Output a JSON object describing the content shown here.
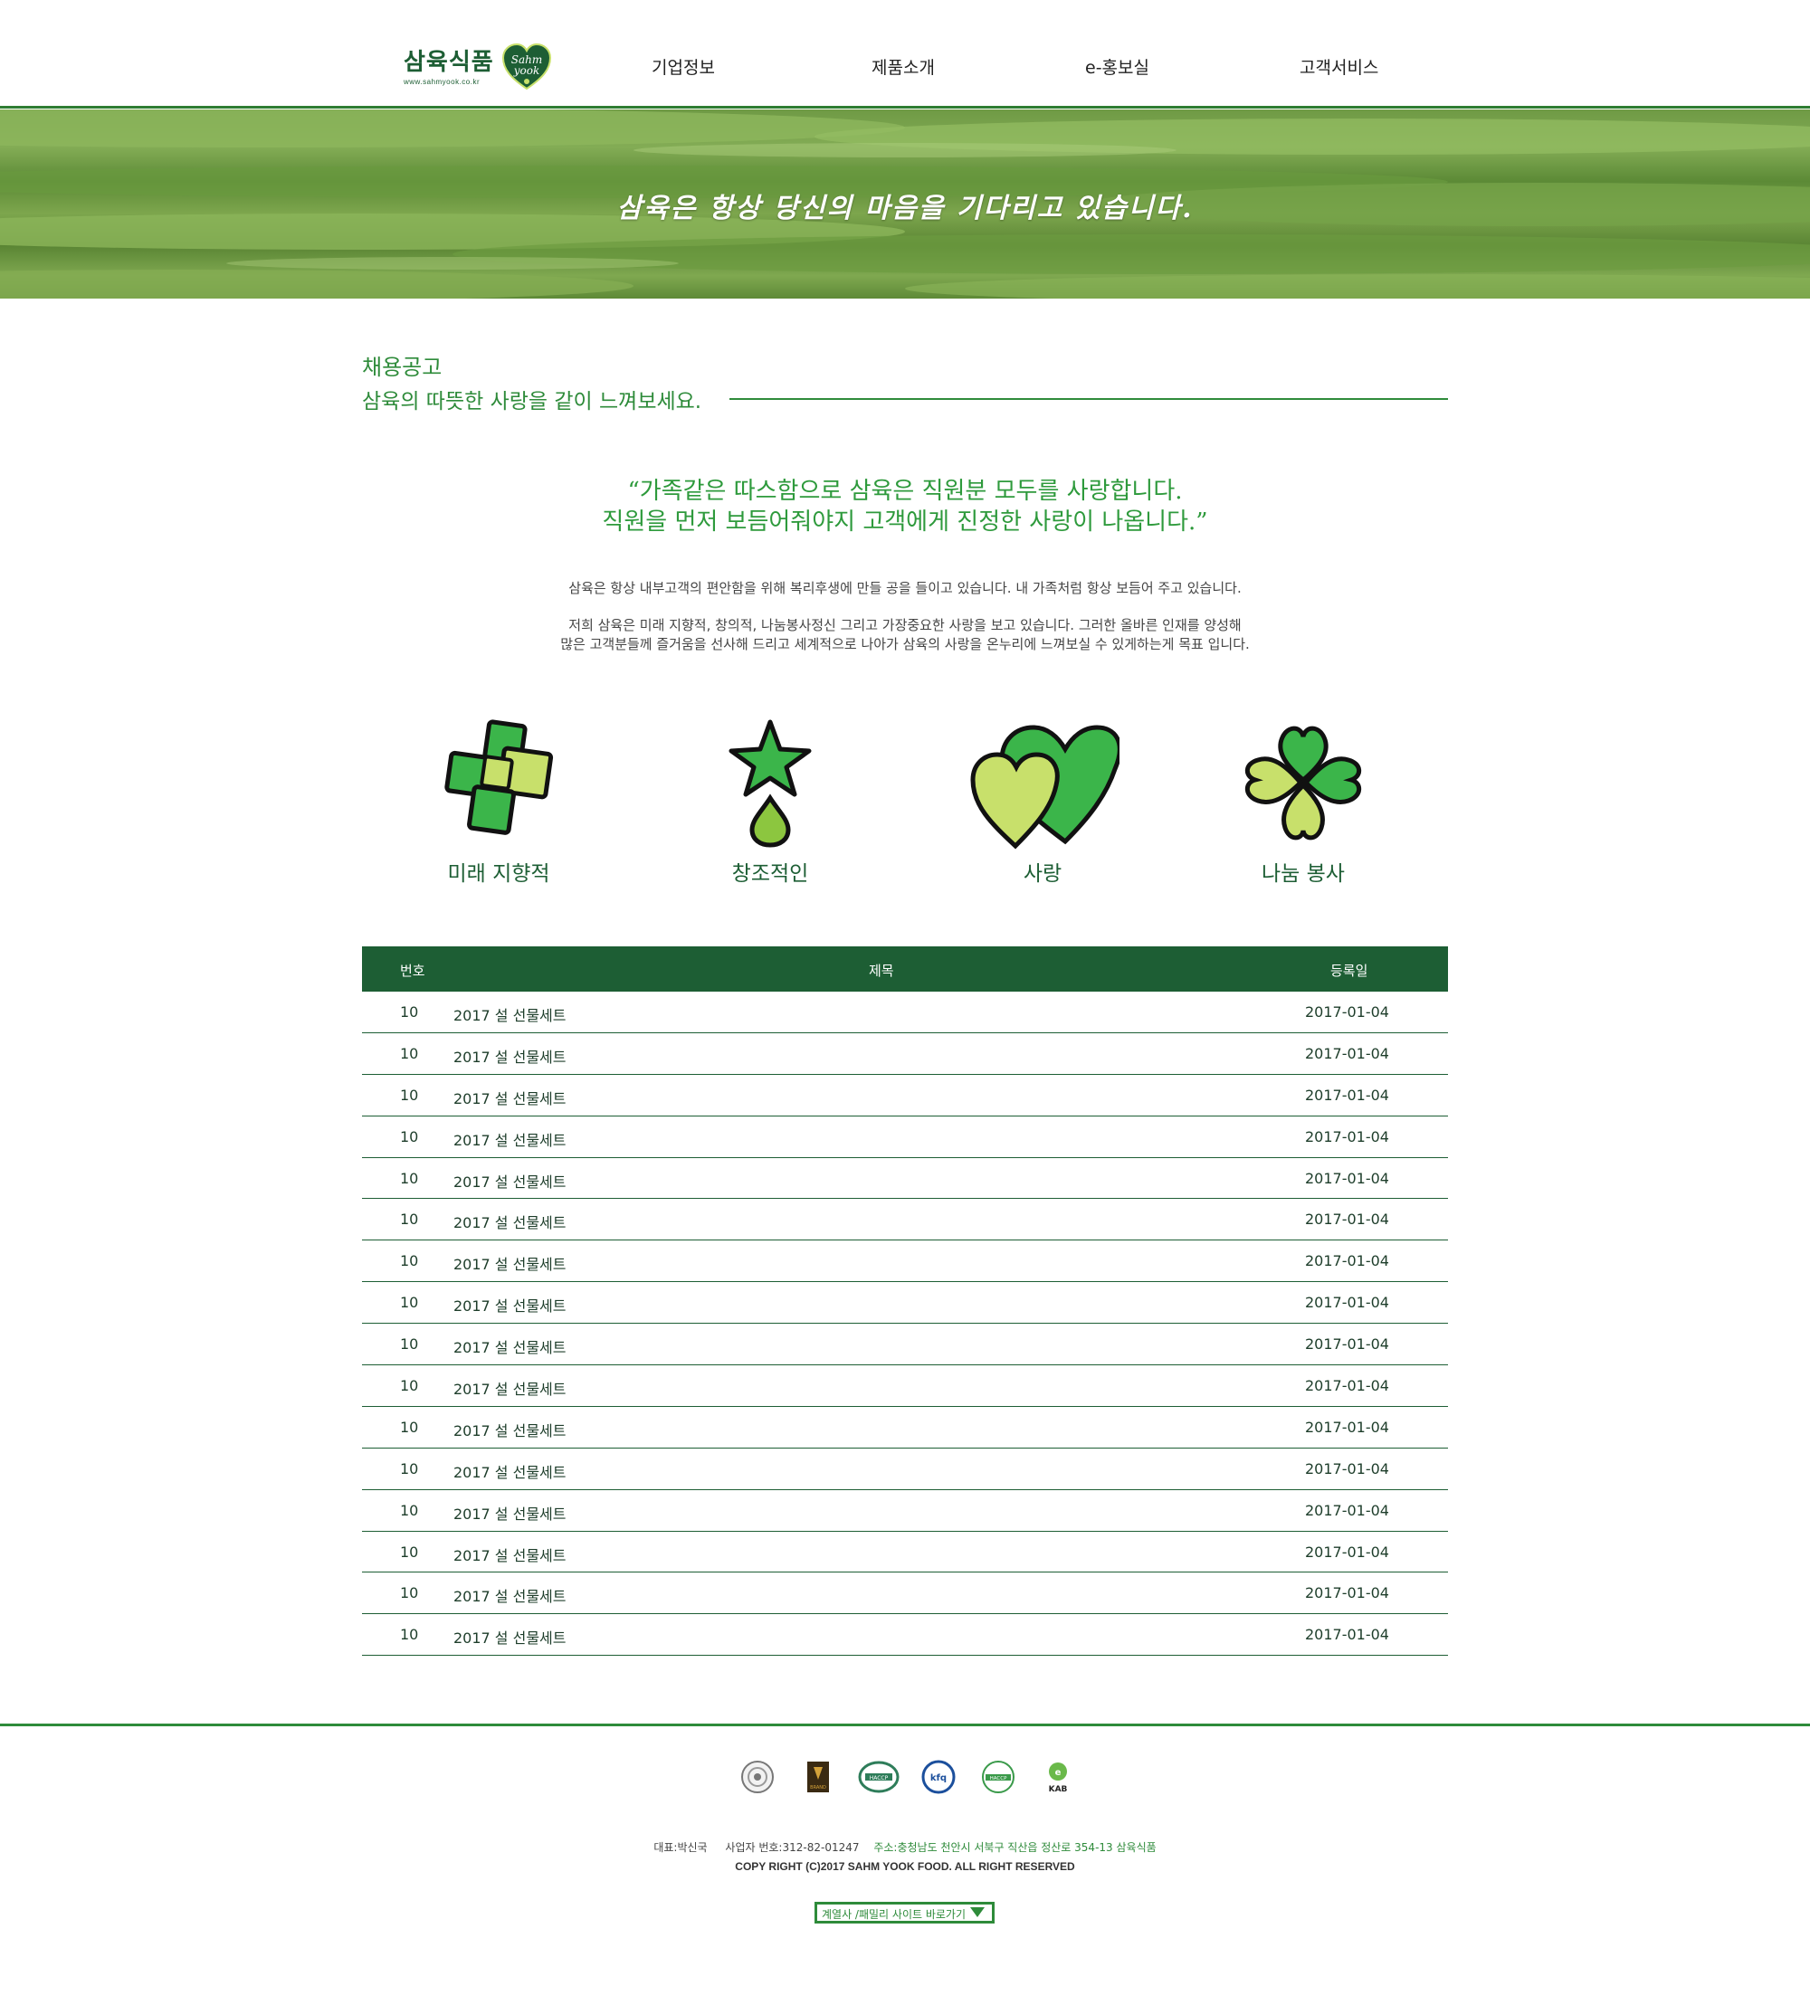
{
  "header": {
    "logo_name": "삼육식품",
    "logo_url": "www.sahmyook.co.kr",
    "logo_badge": "Sahm yook",
    "nav": [
      "기업정보",
      "제품소개",
      "e-홍보실",
      "고객서비스"
    ]
  },
  "banner": {
    "text": "삼육은 항상 당신의 마음을 기다리고 있습니다."
  },
  "section": {
    "title": "채용공고",
    "subtitle": "삼육의 따뜻한 사랑을 같이 느껴보세요."
  },
  "quote": {
    "line1": "“가족같은 따스함으로 삼육은 직원분 모두를 사랑합니다.",
    "line2": "직원을 먼저 보듬어줘야지 고객에게 진정한 사랑이 나옵니다.”"
  },
  "paragraphs": {
    "p1": "삼육은 항상 내부고객의 편안함을 위해 복리후생에 만들 공을 들이고 있습니다. 내 가족처럼 항상 보듬어 주고 있습니다.",
    "p2": "저희 삼육은 미래 지향적, 창의적, 나눔봉사정신 그리고 가장중요한 사랑을 보고 있습니다. 그러한 올바른 인재를 양성해",
    "p3": "많은 고객분들께 즐거움을 선사해 드리고 세계적으로 나아가 삼육의 사랑을 온누리에 느껴보실 수 있게하는게 목표 입니다."
  },
  "values": [
    {
      "label": "미래 지향적",
      "icon": "puzzle-cross-icon"
    },
    {
      "label": "창조적인",
      "icon": "star-drop-icon"
    },
    {
      "label": "사랑",
      "icon": "hearts-icon"
    },
    {
      "label": "나눔 봉사",
      "icon": "clover-icon"
    }
  ],
  "table": {
    "headers": {
      "no": "번호",
      "title": "제목",
      "date": "등록일"
    },
    "rows": [
      {
        "no": "10",
        "title": "2017 설 선물세트",
        "date": "2017-01-04"
      },
      {
        "no": "10",
        "title": "2017 설 선물세트",
        "date": "2017-01-04"
      },
      {
        "no": "10",
        "title": "2017 설 선물세트",
        "date": "2017-01-04"
      },
      {
        "no": "10",
        "title": "2017 설 선물세트",
        "date": "2017-01-04"
      },
      {
        "no": "10",
        "title": "2017 설 선물세트",
        "date": "2017-01-04"
      },
      {
        "no": "10",
        "title": "2017 설 선물세트",
        "date": "2017-01-04"
      },
      {
        "no": "10",
        "title": "2017 설 선물세트",
        "date": "2017-01-04"
      },
      {
        "no": "10",
        "title": "2017 설 선물세트",
        "date": "2017-01-04"
      },
      {
        "no": "10",
        "title": "2017 설 선물세트",
        "date": "2017-01-04"
      },
      {
        "no": "10",
        "title": "2017 설 선물세트",
        "date": "2017-01-04"
      },
      {
        "no": "10",
        "title": "2017 설 선물세트",
        "date": "2017-01-04"
      },
      {
        "no": "10",
        "title": "2017 설 선물세트",
        "date": "2017-01-04"
      },
      {
        "no": "10",
        "title": "2017 설 선물세트",
        "date": "2017-01-04"
      },
      {
        "no": "10",
        "title": "2017 설 선물세트",
        "date": "2017-01-04"
      },
      {
        "no": "10",
        "title": "2017 설 선물세트",
        "date": "2017-01-04"
      },
      {
        "no": "10",
        "title": "2017 설 선물세트",
        "date": "2017-01-04"
      }
    ]
  },
  "footer": {
    "certs": [
      "certification-seal-icon",
      "brand-award-icon",
      "haccp-round-icon",
      "kfq-icon",
      "haccp-icon",
      "kab-icon"
    ],
    "cert_text": {
      "brand": "BRAND",
      "kfq": "kfq",
      "haccp": "HACCP",
      "kab": "KAB"
    },
    "ceo": "대표:박신국",
    "biz_no": "사업자 번호:312-82-01247",
    "address": "주소:충청남도 천안시 서북구 직산읍 정산로 354-13 삼육식품",
    "copyright": "COPY RIGHT (C)2017 SAHM YOOK FOOD. ALL RIGHT RESERVED",
    "family_site": "계열사 /패밀리 사이트 바로가기"
  },
  "colors": {
    "brand_green": "#1d5e34",
    "accent_green": "#2e8b3a",
    "light_green": "#c8e06b",
    "mid_green": "#3bb54a"
  }
}
